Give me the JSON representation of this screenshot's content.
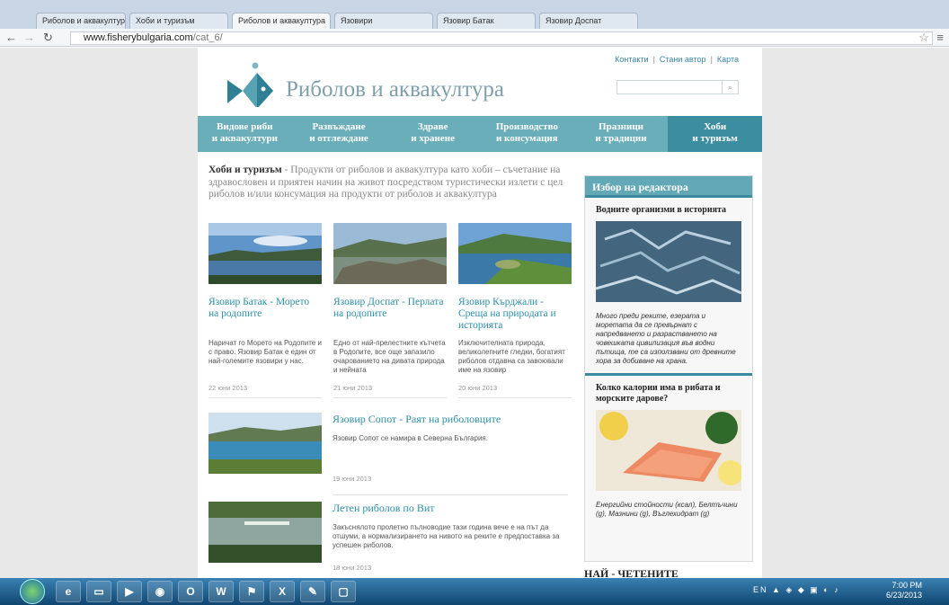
{
  "browser": {
    "tabs": [
      "Риболов и аквакултура",
      "Хоби и туризъм",
      "Риболов и аквакултура",
      "Язовири",
      "Язовир Батак",
      "Язовир Доспат"
    ],
    "url_host": "www.fisherybulgaria.com",
    "url_path": "/cat_6/"
  },
  "site": {
    "top_links": [
      "Контакти",
      "Стани автор",
      "Карта"
    ],
    "title": "Риболов и аквакултура",
    "search_placeholder": ""
  },
  "nav": [
    {
      "line1": "Видове риби",
      "line2": "и аквакултури"
    },
    {
      "line1": "Развъждане",
      "line2": "и отглеждане"
    },
    {
      "line1": "Здраве",
      "line2": "и хранене"
    },
    {
      "line1": "Производство",
      "line2": "и консумация"
    },
    {
      "line1": "Празници",
      "line2": "и традиции"
    },
    {
      "line1": "Хоби",
      "line2": "и туризъм"
    }
  ],
  "intro": {
    "heading": "Хоби и туризъм",
    "text": " - Продукти от риболов и аквакултура като хоби – съчетание на здравословен и приятен начин на живот посредством туристически излети с цел риболов и/или консумация на продукти от риболов и аквакултура"
  },
  "articles": [
    {
      "title": "Язовир Батак - Морето на родопите",
      "desc": "Наричат го Морето на Родопите и с право. Язовир Батак е един от най-големите язовири у нас.",
      "date": "22 юни 2013"
    },
    {
      "title": "Язовир Доспат - Перлата на родопите",
      "desc": "Едно от най-прелестните кътчета в Родопите, все още запазило очарованието на дивата природа и нейната",
      "date": "21 юни 2013"
    },
    {
      "title": "Язовир Кърджали - Среща на природата и историята",
      "desc": "Изключителната природа, великолепните гледки, богатият риболов отдавна са завоювали име на язовир",
      "date": "20 юни 2013"
    }
  ],
  "wide_articles": [
    {
      "title": "Язовир Сопот - Раят на риболовците",
      "desc": "Язовир Сопот се намира в Северна България.",
      "date": "19 юни 2013"
    },
    {
      "title": "Летен риболов по Вит",
      "desc": "Закъснялото пролетно пълноводие тази година вече е на път да отшуми, а нормализирането на нивото на реките е предпоставка за успешен риболов.",
      "date": "18 юни 2013"
    }
  ],
  "sidebar": {
    "heading": "Избор на редактора",
    "items": [
      {
        "title": "Водните организми в историята",
        "desc": "Много преди реките, езерата и моретата да се превърнат с напредването и разрастването на човешката цивилизация във водни пътища, те са използвани от древните хора за добиване на храна."
      },
      {
        "title": "Колко калории има в рибата и морските дарове?",
        "desc": "Енергийни стойности (ксал), Белтъчини (g), Мазнини (g), Въглехидрат (g)"
      }
    ],
    "popular": "НАЙ - ЧЕТЕНИТЕ"
  },
  "taskbar": {
    "lang": "EN",
    "time": "7:00 PM",
    "date": "6/23/2013"
  }
}
